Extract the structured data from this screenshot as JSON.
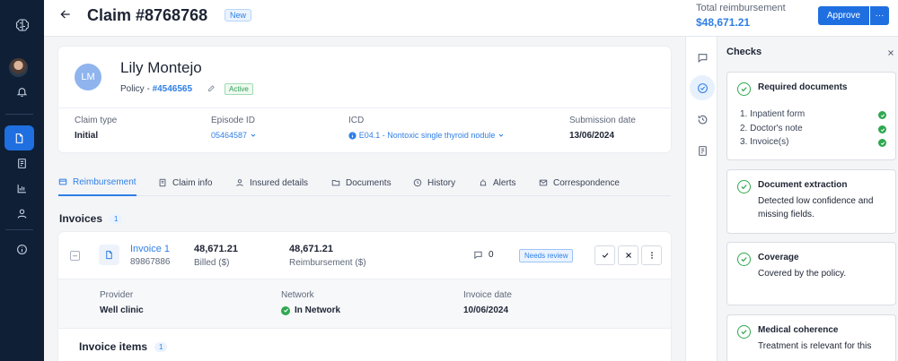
{
  "header": {
    "title": "Claim #8768768",
    "status_badge": "New",
    "total_label": "Total reimbursement",
    "total_value": "$48,671.21",
    "approve_label": "Approve",
    "more_label": "···"
  },
  "claimant": {
    "initials": "LM",
    "name": "Lily Montejo",
    "policy_prefix": "Policy - ",
    "policy_number": "#4546565",
    "policy_status": "Active"
  },
  "fields": {
    "claim_type_label": "Claim type",
    "claim_type_value": "Initial",
    "episode_label": "Episode ID",
    "episode_value": "05464587",
    "icd_label": "ICD",
    "icd_value": "E04.1 - Nontoxic single thyroid nodule",
    "submission_label": "Submission date",
    "submission_value": "13/06/2024"
  },
  "tabs": [
    {
      "label": "Reimbursement"
    },
    {
      "label": "Claim info"
    },
    {
      "label": "Insured details"
    },
    {
      "label": "Documents"
    },
    {
      "label": "History"
    },
    {
      "label": "Alerts"
    },
    {
      "label": "Correspondence"
    }
  ],
  "invoices": {
    "title": "Invoices",
    "count": "1",
    "item": {
      "name": "Invoice 1",
      "number": "89867886",
      "billed_value": "48,671.21",
      "billed_label": "Billed ($)",
      "reimb_value": "48,671.21",
      "reimb_label": "Reimbursement ($)",
      "comments": "0",
      "status": "Needs review",
      "provider_label": "Provider",
      "provider_value": "Well clinic",
      "network_label": "Network",
      "network_value": "In Network",
      "date_label": "Invoice date",
      "date_value": "10/06/2024"
    },
    "items_title": "Invoice items",
    "items_count": "1"
  },
  "checks": {
    "title": "Checks",
    "cards": [
      {
        "title": "Required documents",
        "items": [
          "1. Inpatient form",
          "2. Doctor's note",
          "3. Invoice(s)"
        ]
      },
      {
        "title": "Document extraction",
        "desc": "Detected low confidence and missing fields."
      },
      {
        "title": "Coverage",
        "desc": "Covered by the policy."
      },
      {
        "title": "Medical coherence",
        "desc": "Treatment is relevant for this"
      }
    ]
  },
  "colors": {
    "accent": "#2f7fe6",
    "rail": "#0f1f36",
    "success": "#2fa84f"
  }
}
